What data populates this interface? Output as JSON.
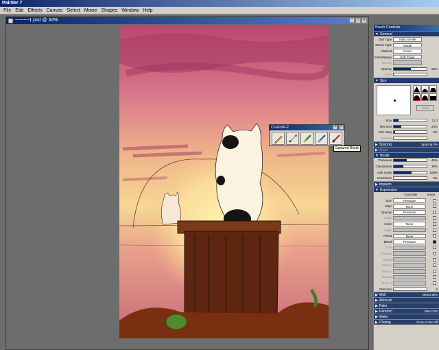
{
  "app_title": "Painter 7",
  "menu": [
    "File",
    "Edit",
    "Effects",
    "Canvas",
    "Select",
    "Movie",
    "Shapes",
    "Window",
    "Help"
  ],
  "document": {
    "title": "~~~~~1.psd @ 34%"
  },
  "palette": {
    "title": "Custom-2",
    "brushes": [
      "pencil-brush",
      "airbrush-brush",
      "oil-brush",
      "bristle-brush",
      "captured-bristle-brush"
    ],
    "tooltip": "Captured Bristle"
  },
  "brush_panel": {
    "title": "Brush Controls",
    "general": {
      "header": "General",
      "dab_type_label": "Dab Type",
      "dab_type": "Static Bristle",
      "stroke_type_label": "Stroke Type",
      "stroke_type": "Single",
      "method_label": "Method",
      "method": "Cover",
      "subcategory_label": "Subcategory",
      "subcategory": "Soft Cover",
      "source_label": "Source",
      "opacity_label": "Opacity",
      "opacity": "52%",
      "opacity_level": 0.52,
      "grain_label": "Grain"
    },
    "size": {
      "header": "Size",
      "build_label": "Build",
      "size_label": "Size",
      "size": "11.3",
      "size_level": 0.15,
      "min_size_label": "Min Size",
      "min_size": "23%",
      "min_size_level": 0.23,
      "size_step_label": "Size Step",
      "size_step": "5%",
      "size_step_level": 0.05,
      "feature_label": "Feature"
    },
    "spacing": {
      "header": "Spacing",
      "summary": "Spacing 0%"
    },
    "angle": {
      "header": "Angle"
    },
    "bristle": {
      "header": "Bristle",
      "thickness_label": "Thickness",
      "thickness": "40%",
      "thickness_level": 0.4,
      "clumpiness_label": "Clumpiness",
      "clumpiness": "30%",
      "clumpiness_level": 0.3,
      "hair_scale_label": "Hair Scale",
      "hair_scale": "108%",
      "hair_scale_level": 0.55,
      "scale_size_label": "Scale/Size",
      "scale_size": "0%",
      "scale_size_level": 0.0
    },
    "impasto": {
      "header": "Impasto"
    },
    "expression": {
      "header": "Expression",
      "controller_label": "Controller",
      "invert_label": "Invert",
      "rows": [
        {
          "label": "Size",
          "value": "Pressure",
          "enabled": true,
          "inverted": false
        },
        {
          "label": "Jitter",
          "value": "None",
          "enabled": true,
          "inverted": false
        },
        {
          "label": "Opacity",
          "value": "Pressure",
          "enabled": true,
          "inverted": false
        },
        {
          "label": "Grain",
          "value": "",
          "enabled": false,
          "inverted": false
        },
        {
          "label": "Color",
          "value": "None",
          "enabled": true,
          "inverted": false
        },
        {
          "label": "Angle",
          "value": "",
          "enabled": false,
          "inverted": false
        },
        {
          "label": "Resat",
          "value": "None",
          "enabled": true,
          "inverted": false
        },
        {
          "label": "Bleed",
          "value": "Pressure",
          "enabled": true,
          "inverted": true
        },
        {
          "label": "Flow",
          "value": "",
          "enabled": false,
          "inverted": false
        },
        {
          "label": "Feature",
          "value": "",
          "enabled": false,
          "inverted": false
        },
        {
          "label": "Depth",
          "value": "",
          "enabled": false,
          "inverted": false
        },
        {
          "label": "Volume",
          "value": "",
          "enabled": false,
          "inverted": false
        },
        {
          "label": "Book 1",
          "value": "",
          "enabled": false,
          "inverted": false
        },
        {
          "label": "Book 2",
          "value": "",
          "enabled": false,
          "inverted": false
        },
        {
          "label": "Book 3",
          "value": "",
          "enabled": false,
          "inverted": false
        }
      ],
      "direction_label": "Direction",
      "direction": "0"
    },
    "collapsed_sections": [
      {
        "name": "Well",
        "summary": "Bleed 38%"
      },
      {
        "name": "Airbrush",
        "summary": ""
      },
      {
        "name": "Rake",
        "summary": ""
      },
      {
        "name": "Random",
        "summary": "Jitter 0.00"
      },
      {
        "name": "Water",
        "summary": ""
      },
      {
        "name": "Cloning",
        "summary": "Clone Color Off"
      }
    ]
  },
  "colors": {
    "title_blue": "#0a246a",
    "panel_gray": "#d4d0c8",
    "workspace_gray": "#6d6d6d"
  }
}
